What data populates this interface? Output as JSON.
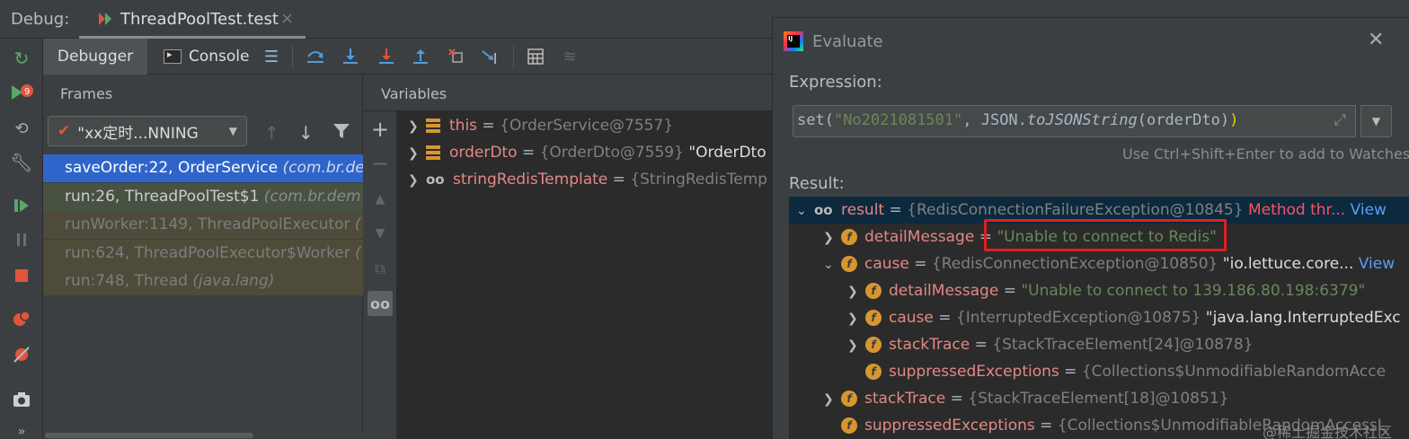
{
  "debug_bar": {
    "label": "Debug:",
    "run_tab": "ThreadPoolTest.test",
    "close": "×"
  },
  "tabs": {
    "debugger": "Debugger",
    "console": "Console"
  },
  "frames": {
    "header": "Frames",
    "thread": "\"xx定时...NNING",
    "items": [
      {
        "method": "saveOrder:22, OrderService",
        "pkg": "(com.br.de"
      },
      {
        "method": "run:26, ThreadPoolTest$1",
        "pkg": "(com.br.dem"
      },
      {
        "method": "runWorker:1149, ThreadPoolExecutor",
        "pkg": "("
      },
      {
        "method": "run:624, ThreadPoolExecutor$Worker",
        "pkg": "("
      },
      {
        "method": "run:748, Thread",
        "pkg": "(java.lang)"
      }
    ]
  },
  "variables": {
    "header": "Variables",
    "items": [
      {
        "name": "this",
        "eq": " = ",
        "type": "{OrderService@7557}",
        "value": ""
      },
      {
        "name": "orderDto",
        "eq": " = ",
        "type": "{OrderDto@7559}",
        "value": " \"OrderDto"
      },
      {
        "name": "stringRedisTemplate",
        "eq": " = ",
        "type": "{StringRedisTemp",
        "value": ""
      }
    ]
  },
  "evaluate": {
    "title": "Evaluate",
    "expression_label": "Expression:",
    "expression": {
      "prefix": "set(",
      "arg1": "\"No2021081501\"",
      "mid": ", JSON.",
      "method": "toJSONString",
      "suffix": "(orderDto)",
      "close": ")"
    },
    "hint": "Use Ctrl+Shift+Enter to add to Watches",
    "result_label": "Result:",
    "result": {
      "name": "result",
      "type": "{RedisConnectionFailureException@10845}",
      "note": "Method thr...",
      "view": "View"
    },
    "tree": [
      {
        "name": "detailMessage",
        "type": "",
        "value": "\"Unable to connect to Redis\"",
        "view": ""
      },
      {
        "name": "cause",
        "type": "{RedisConnectionException@10850}",
        "value": " \"io.lettuce.core...",
        "view": "View"
      },
      {
        "name": "detailMessage",
        "type": "",
        "value": "\"Unable to connect to 139.186.80.198:6379\"",
        "view": ""
      },
      {
        "name": "cause",
        "type": "{InterruptedException@10875}",
        "value": " \"java.lang.InterruptedExc",
        "view": ""
      },
      {
        "name": "stackTrace",
        "type": "{StackTraceElement[24]@10878}",
        "value": "",
        "view": ""
      },
      {
        "name": "suppressedExceptions",
        "type": "{Collections$UnmodifiableRandomAcce",
        "value": "",
        "view": ""
      },
      {
        "name": "stackTrace",
        "type": "{StackTraceElement[18]@10851}",
        "value": "",
        "view": ""
      },
      {
        "name": "suppressedExceptions",
        "type": "{Collections$UnmodifiableRandomAccessL",
        "value": "",
        "view": ""
      }
    ],
    "watermark": "@稀土掘金技术社区"
  },
  "icons": {
    "field": "f",
    "eq": " = "
  },
  "colors": {
    "accent_selected_frame": "#2f65ca",
    "highlight_border": "#e02020",
    "string_green": "#6a8759",
    "link_blue": "#589df6"
  }
}
